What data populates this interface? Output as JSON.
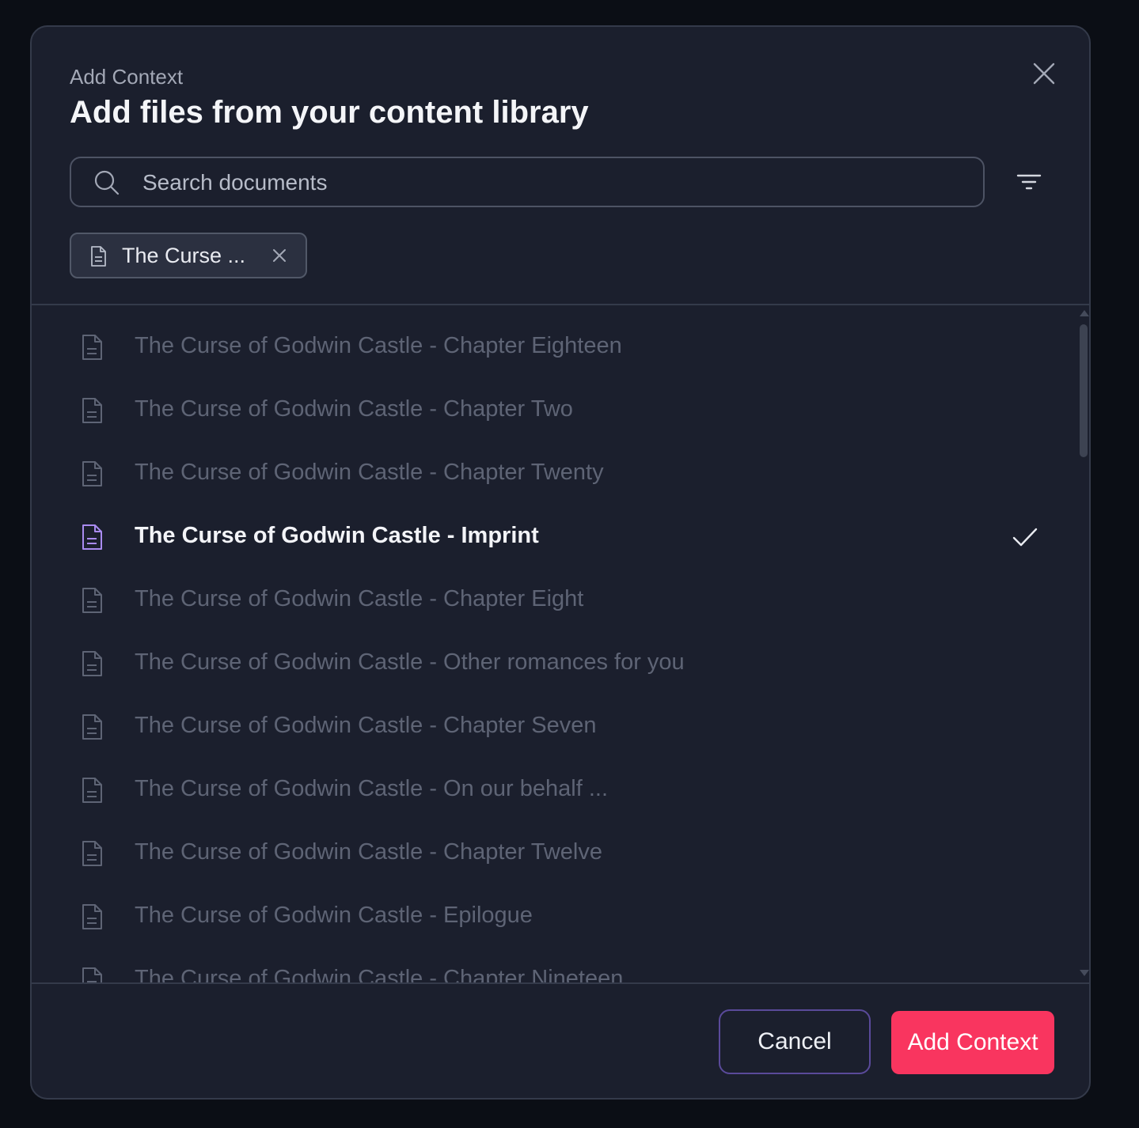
{
  "modal": {
    "eyebrow": "Add Context",
    "title": "Add files from your content library"
  },
  "search": {
    "placeholder": "Search documents",
    "value": ""
  },
  "selected_chips": [
    {
      "label": "The Curse ..."
    }
  ],
  "documents": [
    {
      "label": "The Curse of Godwin Castle - Chapter Eighteen",
      "selected": false
    },
    {
      "label": "The Curse of Godwin Castle - Chapter Two",
      "selected": false
    },
    {
      "label": "The Curse of Godwin Castle - Chapter Twenty",
      "selected": false
    },
    {
      "label": "The Curse of Godwin Castle - Imprint",
      "selected": true
    },
    {
      "label": "The Curse of Godwin Castle - Chapter Eight",
      "selected": false
    },
    {
      "label": "The Curse of Godwin Castle - Other romances for you",
      "selected": false
    },
    {
      "label": "The Curse of Godwin Castle - Chapter Seven",
      "selected": false
    },
    {
      "label": "The Curse of Godwin Castle - On our behalf ...",
      "selected": false
    },
    {
      "label": "The Curse of Godwin Castle - Chapter Twelve",
      "selected": false
    },
    {
      "label": "The Curse of Godwin Castle - Epilogue",
      "selected": false
    },
    {
      "label": "The Curse of Godwin Castle - Chapter Nineteen",
      "selected": false
    }
  ],
  "footer": {
    "cancel_label": "Cancel",
    "add_label": "Add Context"
  },
  "colors": {
    "accent": "#f9355f",
    "selected_icon": "#a98bf0",
    "muted_icon": "#5e6475",
    "cancel_border": "#5a4a9a"
  },
  "icons": {
    "close": "close-icon",
    "search": "search-icon",
    "filter": "filter-icon",
    "document": "document-icon",
    "check": "check-icon"
  }
}
